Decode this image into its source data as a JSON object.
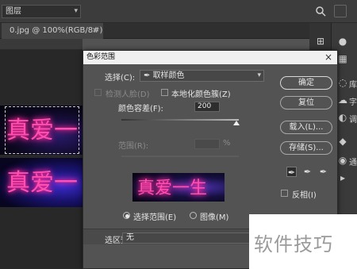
{
  "toolbar": {
    "layer_select": "图层"
  },
  "tabs": [
    {
      "label": "0.jpg @ 100%(RGB/8#)",
      "close": "×"
    }
  ],
  "canvas": {
    "art_text": "真爱一"
  },
  "dock": {
    "labels": [
      "库",
      "字",
      "调",
      "通"
    ]
  },
  "dialog": {
    "title": "色彩范围",
    "close": "×",
    "select_label": "选择(C):",
    "select_value": "取样颜色",
    "detect_faces": "检测人脸(D)",
    "localized_clusters": "本地化颜色簇(Z)",
    "fuzziness_label": "颜色容差(F):",
    "fuzziness_value": "200",
    "range_label": "范围(R):",
    "range_unit": "%",
    "preview_text": "真爱一生",
    "radio_selection": "选择范围(E)",
    "radio_image": "图像(M)",
    "selection_preview_label": "选区预览:",
    "selection_preview_value": "无",
    "buttons": {
      "ok": "确定",
      "reset": "复位",
      "load": "载入(L)...",
      "save": "存储(S)..."
    },
    "invert": "反相(I)"
  },
  "watermark": "软件技巧",
  "colors": {
    "accent_text": "#ff4fb0",
    "dialog_bg": "#535353"
  }
}
